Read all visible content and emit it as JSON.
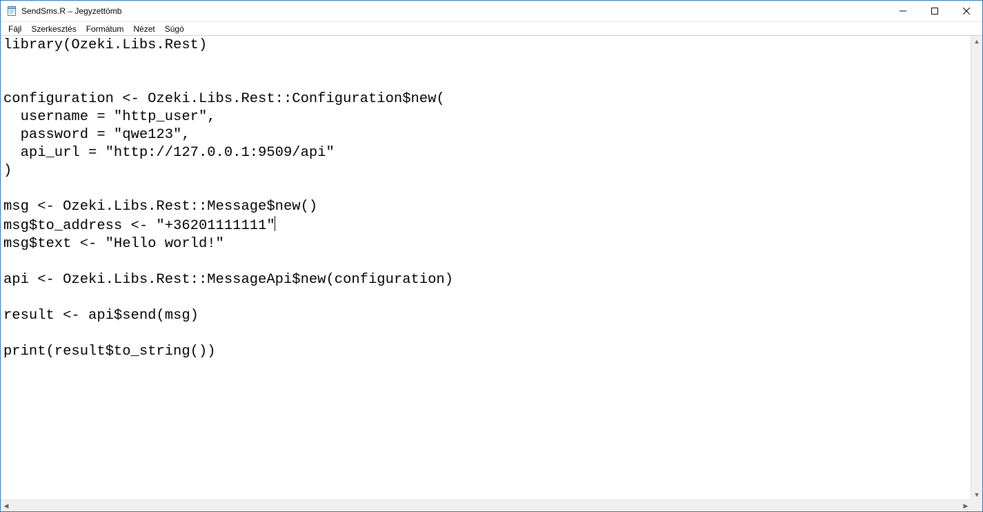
{
  "window": {
    "title": "SendSms.R – Jegyzettömb"
  },
  "menu": {
    "items": [
      "Fájl",
      "Szerkesztés",
      "Formátum",
      "Nézet",
      "Súgó"
    ]
  },
  "editor": {
    "lines": [
      "library(Ozeki.Libs.Rest)",
      "",
      "",
      "configuration <- Ozeki.Libs.Rest::Configuration$new(",
      "  username = \"http_user\",",
      "  password = \"qwe123\",",
      "  api_url = \"http://127.0.0.1:9509/api\"",
      ")",
      "",
      "msg <- Ozeki.Libs.Rest::Message$new()",
      "msg$to_address <- \"+36201111111\"",
      "msg$text <- \"Hello world!\"",
      "",
      "api <- Ozeki.Libs.Rest::MessageApi$new(configuration)",
      "",
      "result <- api$send(msg)",
      "",
      "print(result$to_string())"
    ],
    "caret_line": 10,
    "caret_after": "msg$to_address <- \"+36201111111\""
  }
}
